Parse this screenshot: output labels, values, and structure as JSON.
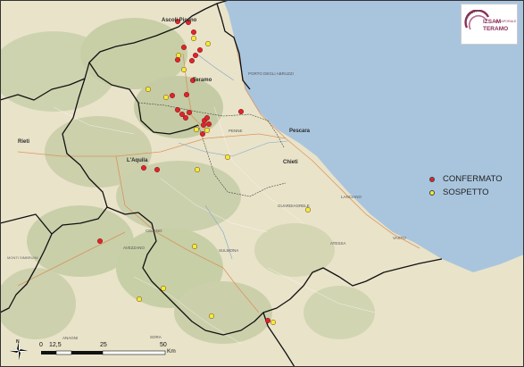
{
  "map": {
    "colors": {
      "sea": "#a9c5de",
      "land": "#e9e3c9",
      "confirmed": "#e0242b",
      "suspected": "#f0ec3a",
      "region_border": "#111111"
    },
    "places": {
      "ascoli_piceno": "Ascoli Piceno",
      "teramo": "Teramo",
      "pescara": "Pescara",
      "chieti": "Chieti",
      "laquila": "L'Aquila",
      "rieti": "Rieti",
      "porto": "PORTO DEGLI ABRUZZI",
      "lanciano": "LANCIANO",
      "vasto": "VASTO",
      "atessa": "ATESSA",
      "sulmona": "SULMONA",
      "celano": "CELANO",
      "avezzano": "AVEZZANO",
      "guardiagrele": "GUARDIAGRELE",
      "penne": "PENNE",
      "anagni": "ANAGNI",
      "sora": "SORA",
      "monti": "MONTI SIMBRUINI"
    },
    "legend": {
      "confirmed": "CONFERMATO",
      "suspected": "SOSPETTO"
    },
    "logo": {
      "line1": "IZSAM",
      "line1_small": "G.CAPORALE",
      "line2": "TERAMO"
    },
    "scale": {
      "ticks": [
        "0",
        "12,5",
        "25",
        "50"
      ],
      "unit": "Km"
    },
    "compass": "N"
  }
}
